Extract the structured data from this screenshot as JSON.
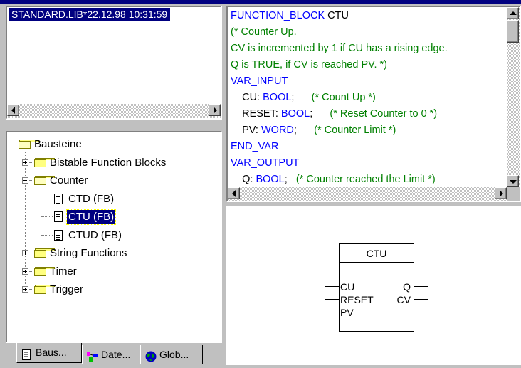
{
  "library": {
    "title": "STANDARD.LIB*22.12.98 10:31:59"
  },
  "tree": {
    "root": "Bausteine",
    "items": [
      {
        "label": "Bistable Function Blocks",
        "type": "folder",
        "expanded": false
      },
      {
        "label": "Counter",
        "type": "folder",
        "expanded": true
      },
      {
        "label": "CTD (FB)",
        "type": "doc"
      },
      {
        "label": "CTU (FB)",
        "type": "doc",
        "selected": true
      },
      {
        "label": "CTUD (FB)",
        "type": "doc"
      },
      {
        "label": "String Functions",
        "type": "folder",
        "expanded": false
      },
      {
        "label": "Timer",
        "type": "folder",
        "expanded": false
      },
      {
        "label": "Trigger",
        "type": "folder",
        "expanded": false
      }
    ]
  },
  "tabs": [
    {
      "label": "Baus...",
      "icon": "document-icon",
      "active": true
    },
    {
      "label": "Date...",
      "icon": "datatype-icon",
      "active": false
    },
    {
      "label": "Glob...",
      "icon": "globe-icon",
      "active": false
    }
  ],
  "code": {
    "lines": [
      [
        {
          "t": "FUNCTION_BLOCK ",
          "c": "kw"
        },
        {
          "t": "CTU",
          "c": "tx"
        }
      ],
      [
        {
          "t": "(* Counter Up.",
          "c": "cm"
        }
      ],
      [
        {
          "t": "CV is incremented by 1 if CU has a rising edge.",
          "c": "cm"
        }
      ],
      [
        {
          "t": "Q is TRUE, if CV is reached PV. *)",
          "c": "cm"
        }
      ],
      [
        {
          "t": "VAR_INPUT",
          "c": "kw"
        }
      ],
      [
        {
          "t": "    CU: ",
          "c": "tx"
        },
        {
          "t": "BOOL",
          "c": "kw"
        },
        {
          "t": ";      ",
          "c": "tx"
        },
        {
          "t": "(* Count Up *)",
          "c": "cm"
        }
      ],
      [
        {
          "t": "    RESET: ",
          "c": "tx"
        },
        {
          "t": "BOOL",
          "c": "kw"
        },
        {
          "t": ";      ",
          "c": "tx"
        },
        {
          "t": "(* Reset Counter to 0 *)",
          "c": "cm"
        }
      ],
      [
        {
          "t": "    PV: ",
          "c": "tx"
        },
        {
          "t": "WORD",
          "c": "kw"
        },
        {
          "t": ";      ",
          "c": "tx"
        },
        {
          "t": "(* Counter Limit *)",
          "c": "cm"
        }
      ],
      [
        {
          "t": "END_VAR",
          "c": "kw"
        }
      ],
      [
        {
          "t": "VAR_OUTPUT",
          "c": "kw"
        }
      ],
      [
        {
          "t": "    Q: ",
          "c": "tx"
        },
        {
          "t": "BOOL",
          "c": "kw"
        },
        {
          "t": ";   ",
          "c": "tx"
        },
        {
          "t": "(* Counter reached the Limit *)",
          "c": "cm"
        }
      ]
    ]
  },
  "block": {
    "name": "CTU",
    "inputs": [
      "CU",
      "RESET",
      "PV"
    ],
    "outputs": [
      "Q",
      "CV"
    ]
  },
  "colors": {
    "keyword": "#0000ff",
    "comment": "#008000",
    "selection": "#000080"
  }
}
